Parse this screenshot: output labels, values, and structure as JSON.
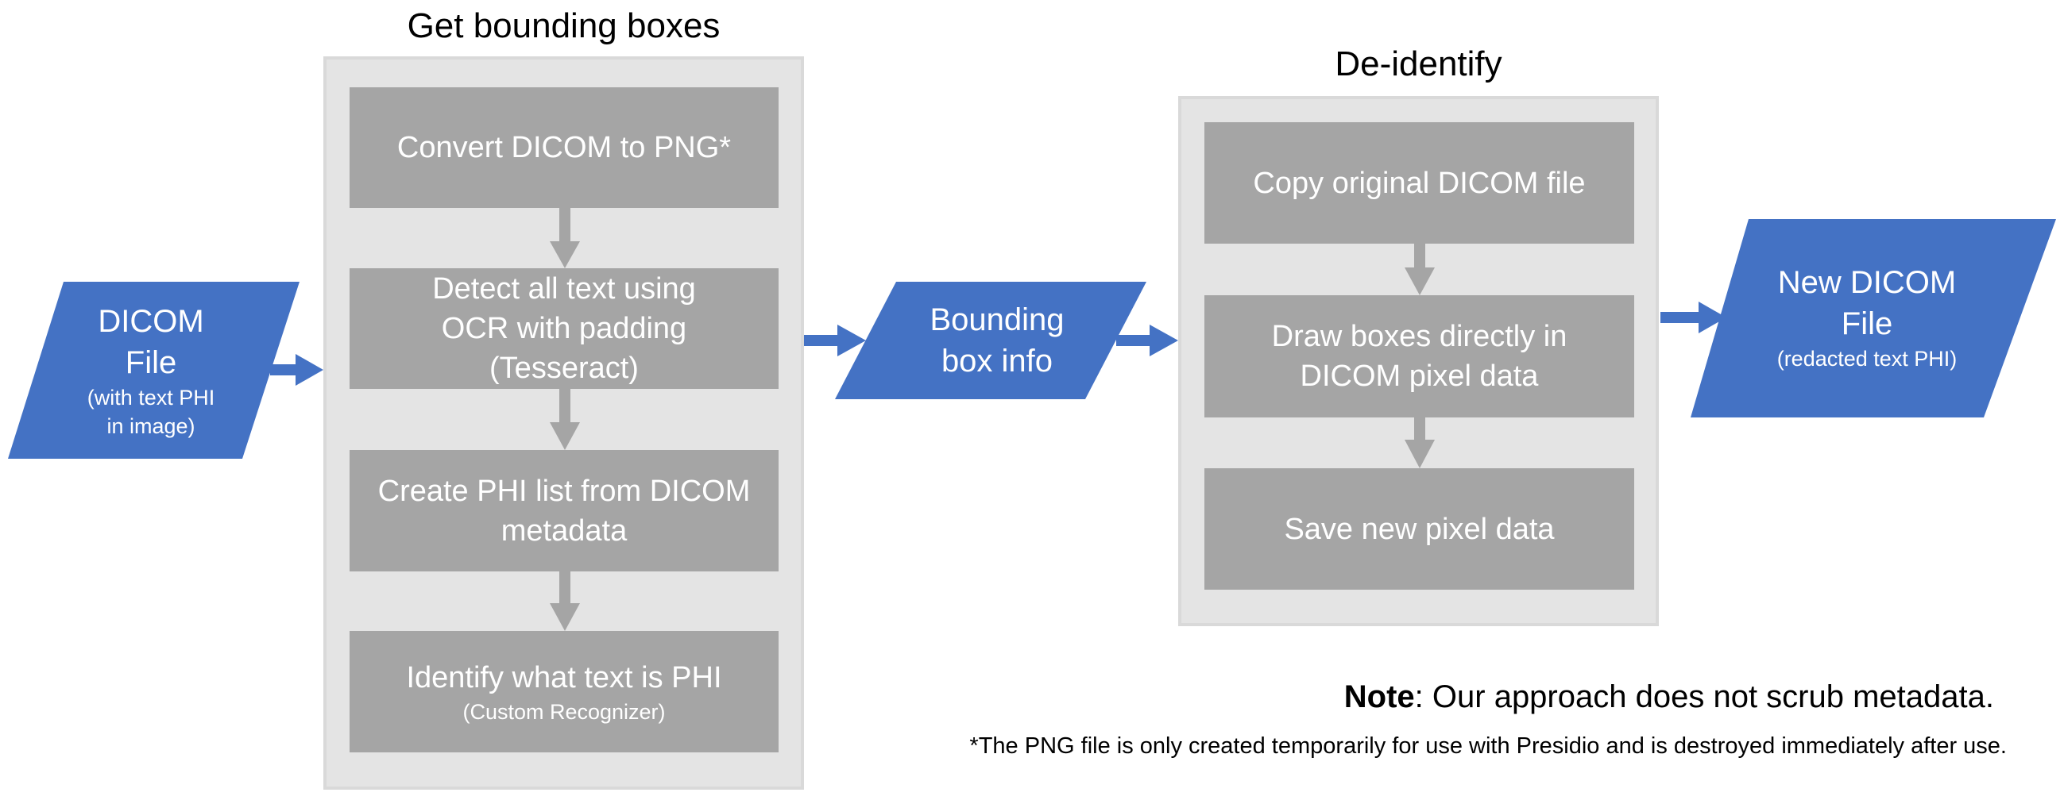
{
  "colors": {
    "io_fill": "#4472c4",
    "step_fill": "#a5a5a5",
    "container_fill": "#e4e4e4",
    "container_border": "#d9d9d9",
    "gray_arrow": "#a5a5a5",
    "blue_arrow": "#4472c4"
  },
  "input": {
    "title_line1": "DICOM",
    "title_line2": "File",
    "sub_line1": "(with text PHI",
    "sub_line2": "in image)"
  },
  "get_bounding_boxes": {
    "title": "Get bounding boxes",
    "steps": [
      {
        "text": "Convert DICOM to PNG*",
        "sub": ""
      },
      {
        "text": "Detect all text using OCR with padding (Tesseract)",
        "sub": ""
      },
      {
        "text": "Create PHI list from DICOM metadata",
        "sub": ""
      },
      {
        "text": "Identify what text is PHI",
        "sub": "(Custom Recognizer)"
      }
    ]
  },
  "intermediate": {
    "line1": "Bounding",
    "line2": "box info"
  },
  "de_identify": {
    "title": "De-identify",
    "steps": [
      {
        "text": "Copy original DICOM file"
      },
      {
        "text": "Draw boxes directly in DICOM pixel data"
      },
      {
        "text": "Save new pixel data"
      }
    ]
  },
  "output": {
    "title_line1": "New DICOM",
    "title_line2": "File",
    "sub": "(redacted text PHI)"
  },
  "note": {
    "label": "Note",
    "text": ": Our approach does not scrub metadata."
  },
  "footnote": "*The PNG file is only created temporarily for use with Presidio and is destroyed immediately after use."
}
